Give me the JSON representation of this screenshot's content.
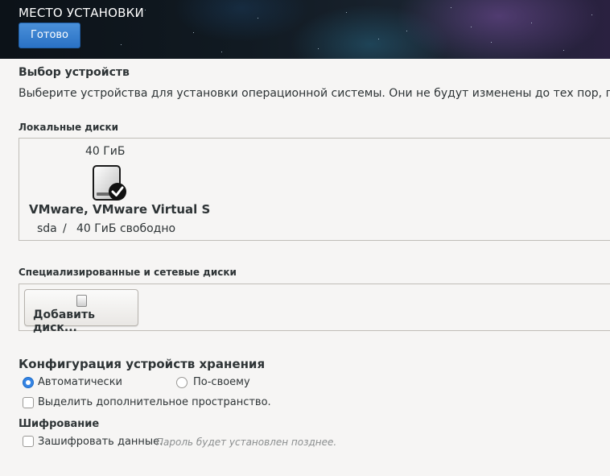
{
  "header": {
    "title": "МЕСТО УСТАНОВКИ",
    "done_label": "Готово"
  },
  "device_selection": {
    "title": "Выбор устройств",
    "description": "Выберите устройства для установки операционной системы. Они не будут изменены до тех пор, пок"
  },
  "local_disks": {
    "label": "Локальные диски",
    "disks": [
      {
        "size": "40 ГиБ",
        "name": "VMware, VMware Virtual S",
        "device": "sda",
        "separator": "/",
        "free": "40 ГиБ свободно",
        "icon": "hard-disk-icon",
        "selected": true
      }
    ]
  },
  "specialized_disks": {
    "label": "Специализированные и сетевые диски",
    "add_button": "Добавить диск..."
  },
  "storage_config": {
    "title": "Конфигурация устройств хранения",
    "options": [
      {
        "label": "Автоматически",
        "selected": true
      },
      {
        "label": "По-своему",
        "selected": false
      }
    ],
    "extra_space": {
      "label": "Выделить дополнительное пространство.",
      "checked": false
    }
  },
  "encryption": {
    "title": "Шифрование",
    "encrypt": {
      "label": "Зашифровать данные.",
      "checked": false
    },
    "hint": "Пароль будет установлен позднее."
  },
  "colors": {
    "accent": "#3584e4",
    "done_button": "#2a72c5",
    "background": "#f6f5f4"
  }
}
